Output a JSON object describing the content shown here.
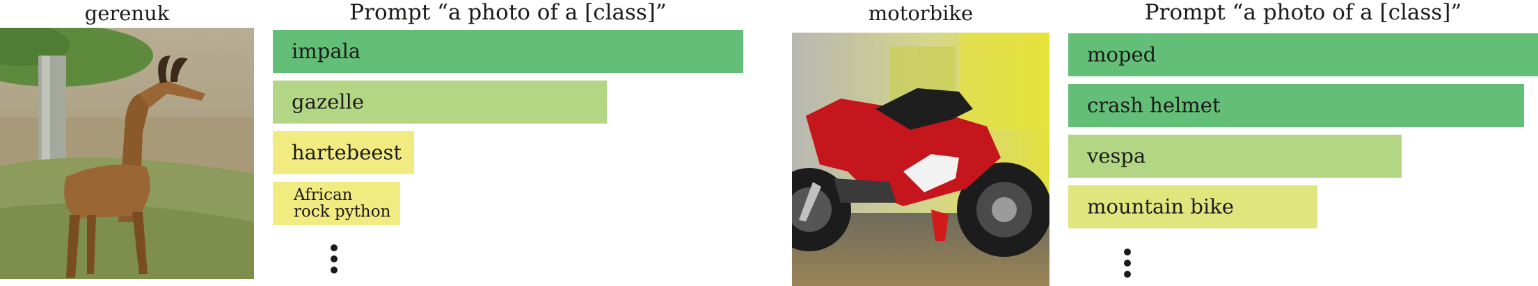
{
  "colors": {
    "high": "#63bf78",
    "mid": "#b2d683",
    "low": "#f2eb82",
    "mid_low": "#e0e67d"
  },
  "panels": [
    {
      "image_title": "gerenuk",
      "prompt_title": "Prompt “a photo of a [class]”"
    },
    {
      "image_title": "motorbike",
      "prompt_title": "Prompt “a photo of a [class]”"
    }
  ],
  "chart_data": [
    {
      "type": "bar",
      "orientation": "horizontal",
      "title": "Prompt “a photo of a [class]”",
      "categories": [
        "impala",
        "gazelle",
        "hartebeest",
        "African\nrock python"
      ],
      "values": [
        1.0,
        0.71,
        0.3,
        0.27
      ],
      "colors": [
        "#63bf78",
        "#b2d683",
        "#f2eb82",
        "#f2eb82"
      ],
      "xlim": [
        0,
        1.0
      ]
    },
    {
      "type": "bar",
      "orientation": "horizontal",
      "title": "Prompt “a photo of a [class]”",
      "categories": [
        "moped",
        "crash helmet",
        "vespa",
        "mountain bike"
      ],
      "values": [
        1.0,
        0.97,
        0.71,
        0.53
      ],
      "colors": [
        "#63bf78",
        "#63bf78",
        "#b2d683",
        "#e0e67d"
      ],
      "xlim": [
        0,
        1.0
      ]
    }
  ]
}
